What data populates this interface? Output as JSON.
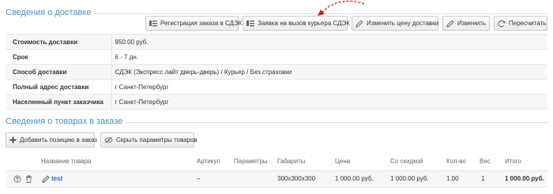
{
  "delivery": {
    "title": "Сведения о доставке",
    "buttons": {
      "register": "Регистрация заказа в СДЭК",
      "courier": "Заявка на вызов курьера СДЭК",
      "change_price": "Изменить цену доставки",
      "edit": "Изменить",
      "recalc": "Пересчитать"
    },
    "rows": [
      {
        "label": "Стоимость доставки",
        "value": "950.00 руб."
      },
      {
        "label": "Срок",
        "value": "6 - 7 дн."
      },
      {
        "label": "Способ доставки",
        "value": "СДЭК (Экспресс лайт дверь-дверь) / Курьер / Без страховки"
      },
      {
        "label": "Полный адрес доставки",
        "value": "г Санкт-Петербург"
      },
      {
        "label": "Населенный пункт заказчика",
        "value": "г Санкт-Петербург"
      }
    ]
  },
  "products": {
    "title": "Сведения о товарах в заказе",
    "buttons": {
      "add": "Добавить позицию в заказ",
      "hide_params": "Скрыть параметры товаров"
    },
    "columns": {
      "name": "Название товара",
      "article": "Артикул",
      "params": "Параметры",
      "dims": "Габариты",
      "price": "Цена",
      "discount": "Со скидкой",
      "qty": "Кол-во",
      "weight": "Вес",
      "total": "Итого"
    },
    "items": [
      {
        "name": "test",
        "article": "–",
        "params": "",
        "dims": "300x300x300",
        "price": "1 000.00 руб.",
        "discount": "1 000.00 руб.",
        "qty": "1.00",
        "weight": "1",
        "total": "1 000.00 руб."
      }
    ]
  },
  "colors": {
    "accent": "#4a8fc7",
    "annotation_arrow": "#cc1f1f",
    "link": "#2b6cb0"
  },
  "icons": [
    "register-icon",
    "courier-icon",
    "pencil-icon",
    "recalc-icon",
    "plus-icon",
    "eye-slash-icon",
    "move-icon",
    "trash-icon"
  ]
}
